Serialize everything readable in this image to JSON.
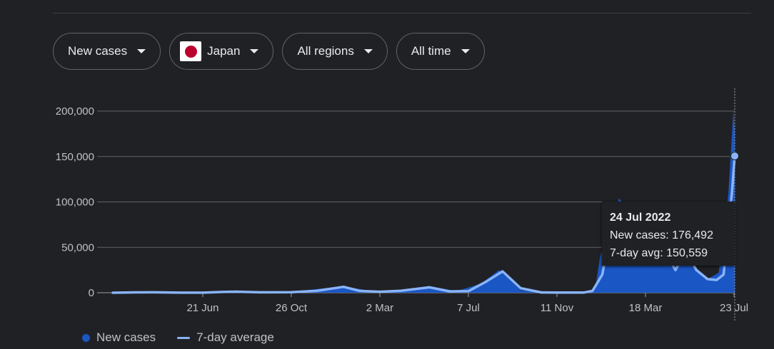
{
  "filters": {
    "metric": "New cases",
    "country": "Japan",
    "region": "All regions",
    "period": "All time"
  },
  "chart_data": {
    "type": "area",
    "y_ticks": [
      0,
      50000,
      100000,
      150000,
      200000
    ],
    "y_tick_labels": [
      "0",
      "50,000",
      "100,000",
      "150,000",
      "200,000"
    ],
    "x_tick_labels": [
      "21 Jun",
      "26 Oct",
      "2 Mar",
      "7 Jul",
      "11 Nov",
      "18 Mar",
      "23 Jul"
    ],
    "x_ticks": [
      "2020-06-21",
      "2020-10-26",
      "2021-03-02",
      "2021-07-07",
      "2021-11-11",
      "2022-03-18",
      "2022-07-23"
    ],
    "ylim": [
      0,
      200000
    ],
    "grid": true,
    "legend_position": "bottom-left",
    "series": [
      {
        "name": "New cases",
        "color": "#1a56c4",
        "kind": "bars",
        "x": [
          "2020-02-13",
          "2020-04-10",
          "2020-06-20",
          "2020-08-05",
          "2020-10-20",
          "2021-01-10",
          "2021-02-20",
          "2021-04-01",
          "2021-05-15",
          "2021-06-20",
          "2021-07-25",
          "2021-08-20",
          "2021-09-20",
          "2021-10-20",
          "2021-12-20",
          "2022-01-05",
          "2022-01-12",
          "2022-02-08",
          "2022-03-20",
          "2022-04-20",
          "2022-05-15",
          "2022-06-15",
          "2022-07-01",
          "2022-07-15",
          "2022-07-22",
          "2022-07-24"
        ],
        "y": [
          50,
          500,
          100,
          1300,
          700,
          7200,
          1500,
          2800,
          7000,
          1700,
          10000,
          25000,
          3000,
          250,
          300,
          5000,
          40000,
          104000,
          65000,
          55000,
          35000,
          15000,
          22000,
          110000,
          200000,
          176492
        ]
      },
      {
        "name": "7-day average",
        "color": "#8ab4f8",
        "kind": "line",
        "x": [
          "2020-02-13",
          "2020-03-15",
          "2020-04-12",
          "2020-05-20",
          "2020-06-21",
          "2020-07-20",
          "2020-08-07",
          "2020-09-10",
          "2020-10-26",
          "2020-12-01",
          "2021-01-09",
          "2021-02-01",
          "2021-03-02",
          "2021-04-01",
          "2021-05-12",
          "2021-06-10",
          "2021-07-07",
          "2021-08-01",
          "2021-08-25",
          "2021-09-20",
          "2021-10-20",
          "2021-11-11",
          "2021-12-20",
          "2022-01-01",
          "2022-01-15",
          "2022-01-25",
          "2022-02-05",
          "2022-02-15",
          "2022-02-25",
          "2022-03-10",
          "2022-03-25",
          "2022-04-15",
          "2022-04-30",
          "2022-05-15",
          "2022-05-30",
          "2022-06-15",
          "2022-06-28",
          "2022-07-08",
          "2022-07-15",
          "2022-07-20",
          "2022-07-24"
        ],
        "y": [
          0,
          400,
          500,
          100,
          60,
          900,
          1200,
          500,
          600,
          2000,
          6500,
          2000,
          1100,
          2200,
          6000,
          1500,
          1700,
          12000,
          23500,
          5000,
          300,
          150,
          200,
          2000,
          20000,
          60000,
          85000,
          92000,
          88000,
          65000,
          50000,
          45000,
          25000,
          45000,
          25000,
          15000,
          14000,
          20000,
          75000,
          110000,
          150559
        ]
      }
    ],
    "tooltip": {
      "date": "24 Jul 2022",
      "new_cases_label": "New cases: 176,492",
      "avg_label": "7-day avg: 150,559"
    }
  },
  "legend": {
    "cases_label": "New cases",
    "avg_label": "7-day average"
  }
}
